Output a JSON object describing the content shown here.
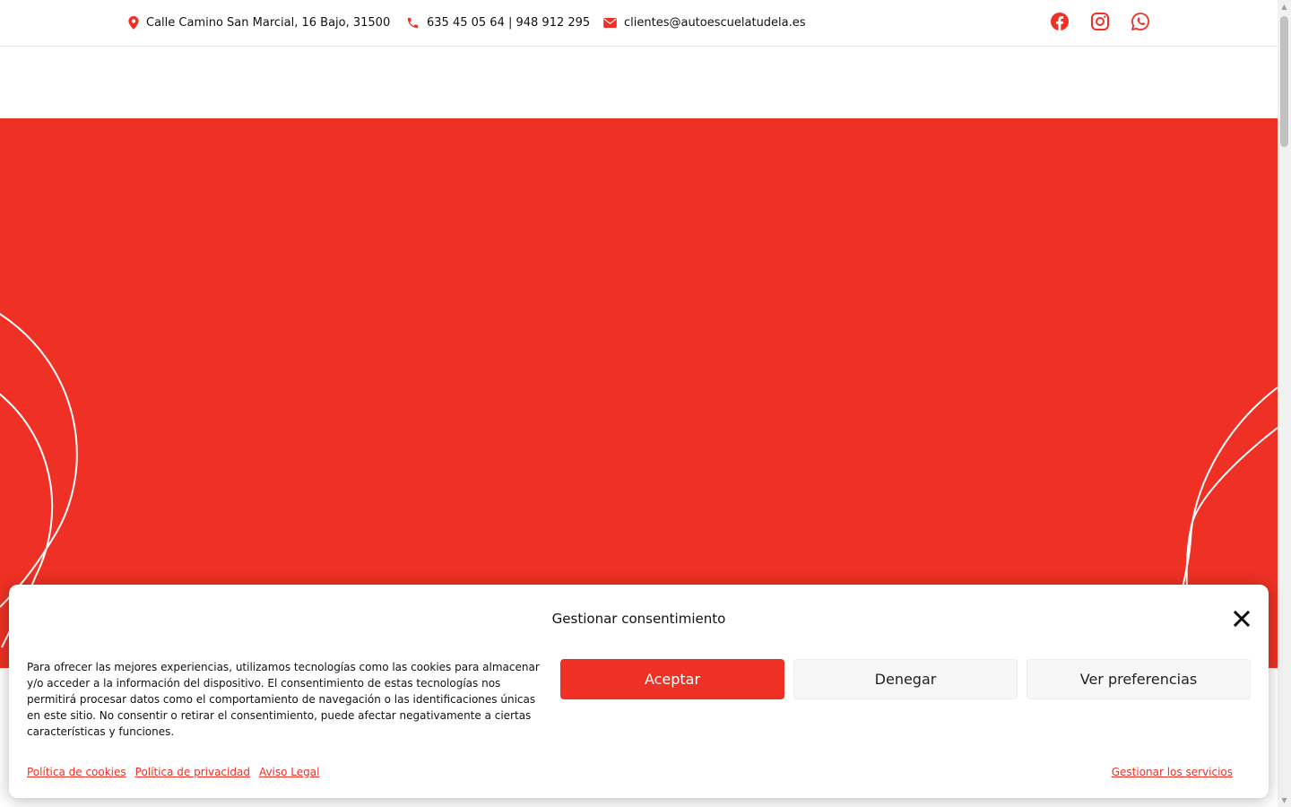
{
  "colors": {
    "brand": "#ee3124",
    "text": "#111111"
  },
  "topbar": {
    "address": {
      "icon": "map-marker-icon",
      "text": "Calle Camino San Marcial, 16 Bajo, 31500"
    },
    "phone": {
      "icon": "phone-icon",
      "text": "635 45 05 64 | 948 912 295"
    },
    "email": {
      "icon": "envelope-icon",
      "text": "clientes@autoescuelatudela.es"
    },
    "social": [
      "facebook-icon",
      "instagram-icon",
      "whatsapp-icon"
    ]
  },
  "consent": {
    "title": "Gestionar consentimiento",
    "body": "Para ofrecer las mejores experiencias, utilizamos tecnologías como las cookies para almacenar y/o acceder a la información del dispositivo. El consentimiento de estas tecnologías nos permitirá procesar datos como el comportamiento de navegación o las identificaciones únicas en este sitio. No consentir o retirar el consentimiento, puede afectar negativamente a ciertas características y funciones.",
    "accept_label": "Aceptar",
    "deny_label": "Denegar",
    "prefs_label": "Ver preferencias",
    "links": [
      "Política de cookies",
      "Política de privacidad",
      "Aviso Legal"
    ],
    "manage_label": "Gestionar los servicios"
  }
}
